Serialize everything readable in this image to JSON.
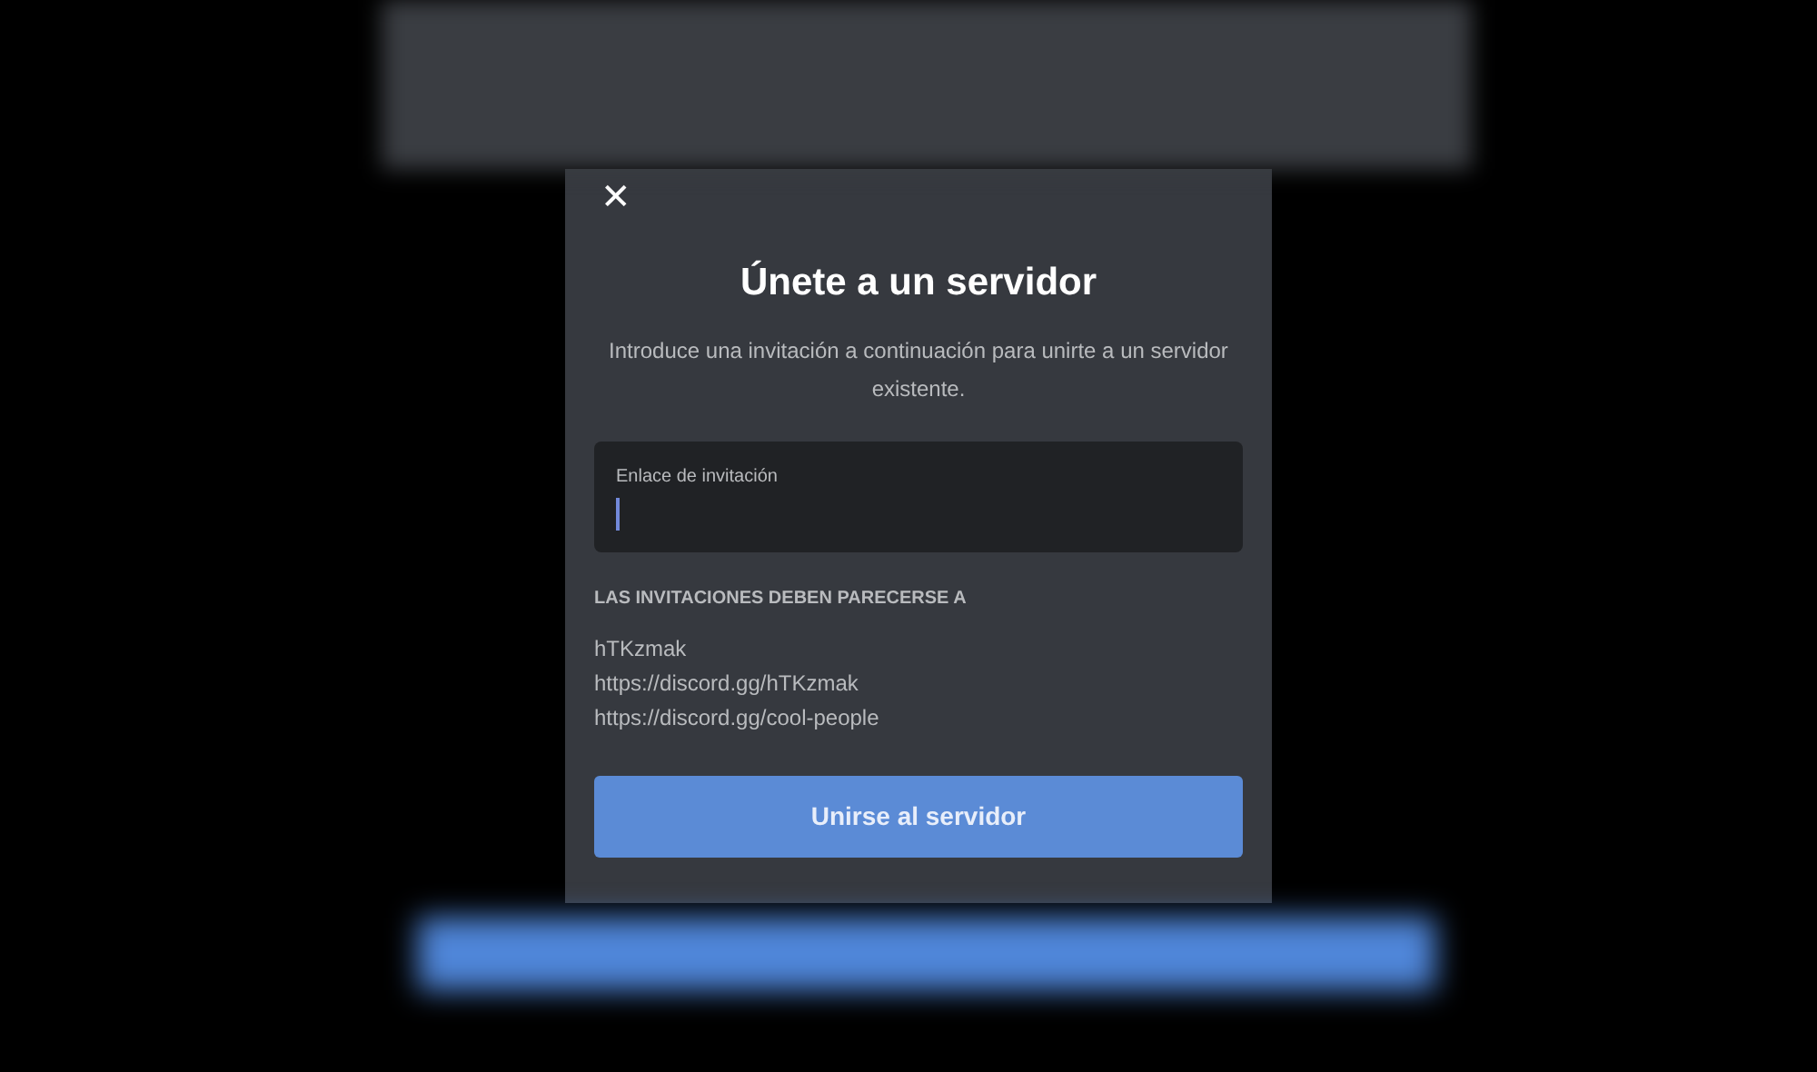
{
  "dialog": {
    "close": "✕",
    "title": "Únete a un servidor",
    "subtitle": "Introduce una invitación a continuación para unirte a un servidor existente.",
    "invite_field": {
      "label": "Enlace de invitación",
      "focused": true
    },
    "examples_heading": "LAS INVITACIONES DEBEN PARECERSE A",
    "examples": [
      "hTKzmak",
      "https://discord.gg/hTKzmak",
      "https://discord.gg/cool-people"
    ],
    "button": "Unirse al servidor"
  }
}
